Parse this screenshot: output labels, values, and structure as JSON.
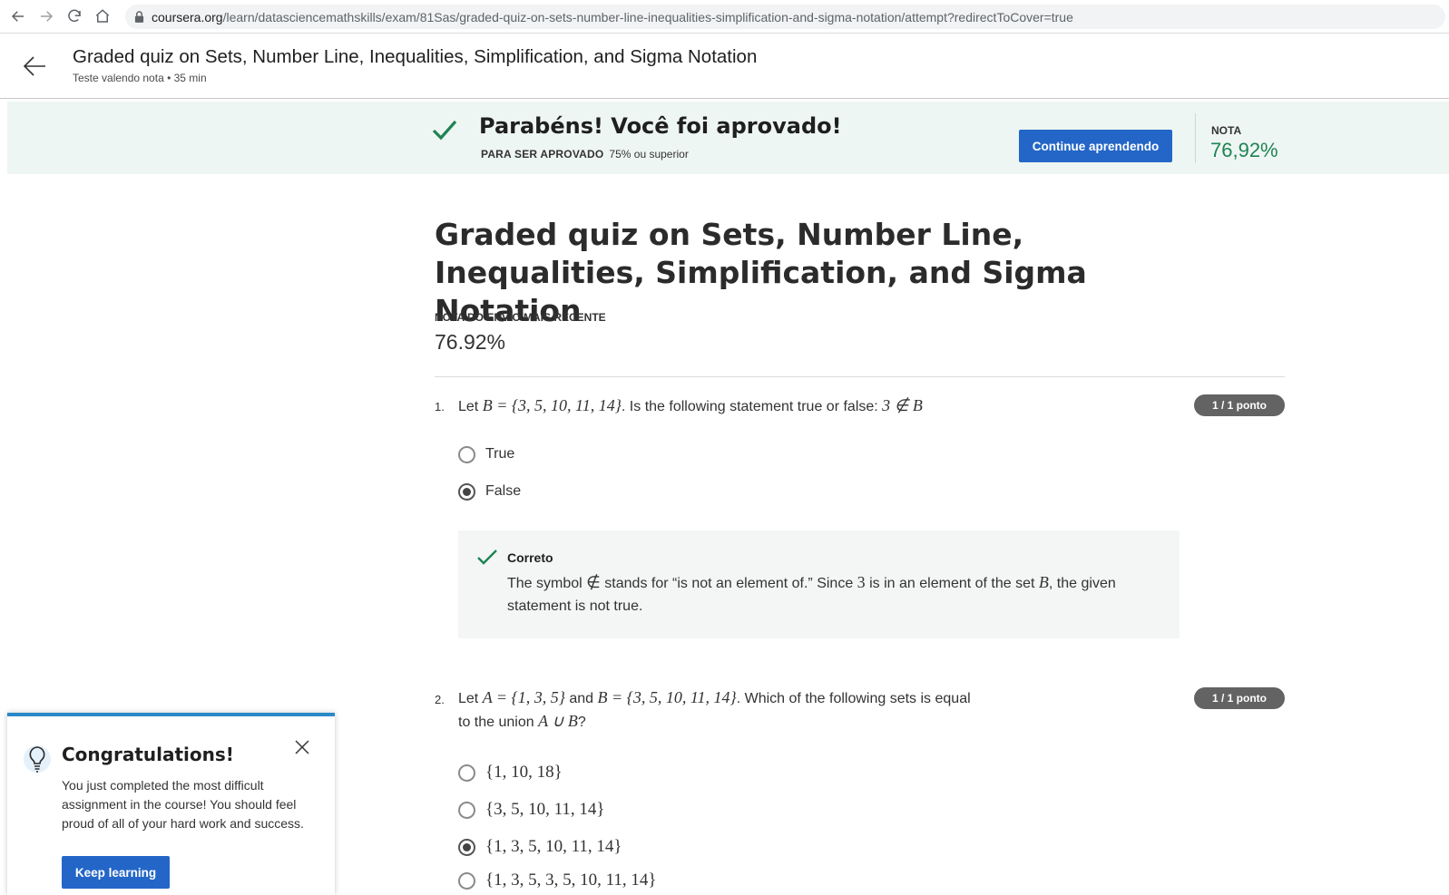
{
  "browser": {
    "url_host": "coursera.org",
    "url_path": "/learn/datasciencemathskills/exam/81Sas/graded-quiz-on-sets-number-line-inequalities-simplification-and-sigma-notation/attempt?redirectToCover=true",
    "icons": [
      "back-icon",
      "forward-icon",
      "reload-icon",
      "home-icon",
      "lock-icon"
    ]
  },
  "header": {
    "title": "Graded quiz on Sets, Number Line, Inequalities, Simplification, and Sigma Notation",
    "subtitle": "Teste valendo nota • 35 min"
  },
  "banner": {
    "title": "Parabéns! Você foi aprovado!",
    "pass_label": "PARA SER APROVADO",
    "pass_value": "75% ou superior",
    "continue_label": "Continue aprendendo",
    "grade_label": "NOTA",
    "grade_value": "76,92%"
  },
  "main": {
    "title": "Graded quiz on Sets, Number Line, Inequalities, Simplification, and Sigma Notation",
    "recent_label": "NOTA DO ENVIO MAIS RECENTE",
    "recent_value": "76.92%"
  },
  "questions": [
    {
      "number": "1.",
      "prefix": "Let",
      "math_set": "B = {3, 5, 10, 11, 14}",
      "middle": ". Is the following statement true or false:",
      "math_stmt": "3 ∉ B",
      "score": "1 / 1 ponto",
      "options": [
        {
          "label": "True",
          "selected": false
        },
        {
          "label": "False",
          "selected": true
        }
      ],
      "feedback": {
        "title": "Correto",
        "text_1": "The symbol",
        "symbol": "∉",
        "text_2": "stands for “is not an element of.” Since",
        "num": "3",
        "text_3": "is in an element of the set",
        "setname": "B",
        "text_4": ", the given statement is not true."
      }
    },
    {
      "number": "2.",
      "prefix": "Let",
      "math_a": "A = {1, 3, 5}",
      "and": "and",
      "math_b": "B = {3, 5, 10, 11, 14}",
      "middle": ". Which of the following sets is equal",
      "line2": "to the union",
      "math_union": "A ∪ B",
      "qmark": "?",
      "score": "1 / 1 ponto",
      "options": [
        {
          "label": "{1, 10, 18}",
          "selected": false
        },
        {
          "label": "{3, 5, 10, 11, 14}",
          "selected": false
        },
        {
          "label": "{1, 3, 5, 10, 11, 14}",
          "selected": true
        },
        {
          "label": "{1, 3, 5, 3, 5, 10, 11, 14}",
          "selected": false
        }
      ]
    }
  ],
  "toast": {
    "title": "Congratulations!",
    "body": "You just completed the most difficult assignment in the course! You should feel proud of all of your hard work and success.",
    "button": "Keep learning"
  },
  "colors": {
    "accent": "#2366c7",
    "success": "#1f8354",
    "banner_bg": "#eef6f3",
    "toast_border": "#2a8ac9"
  }
}
